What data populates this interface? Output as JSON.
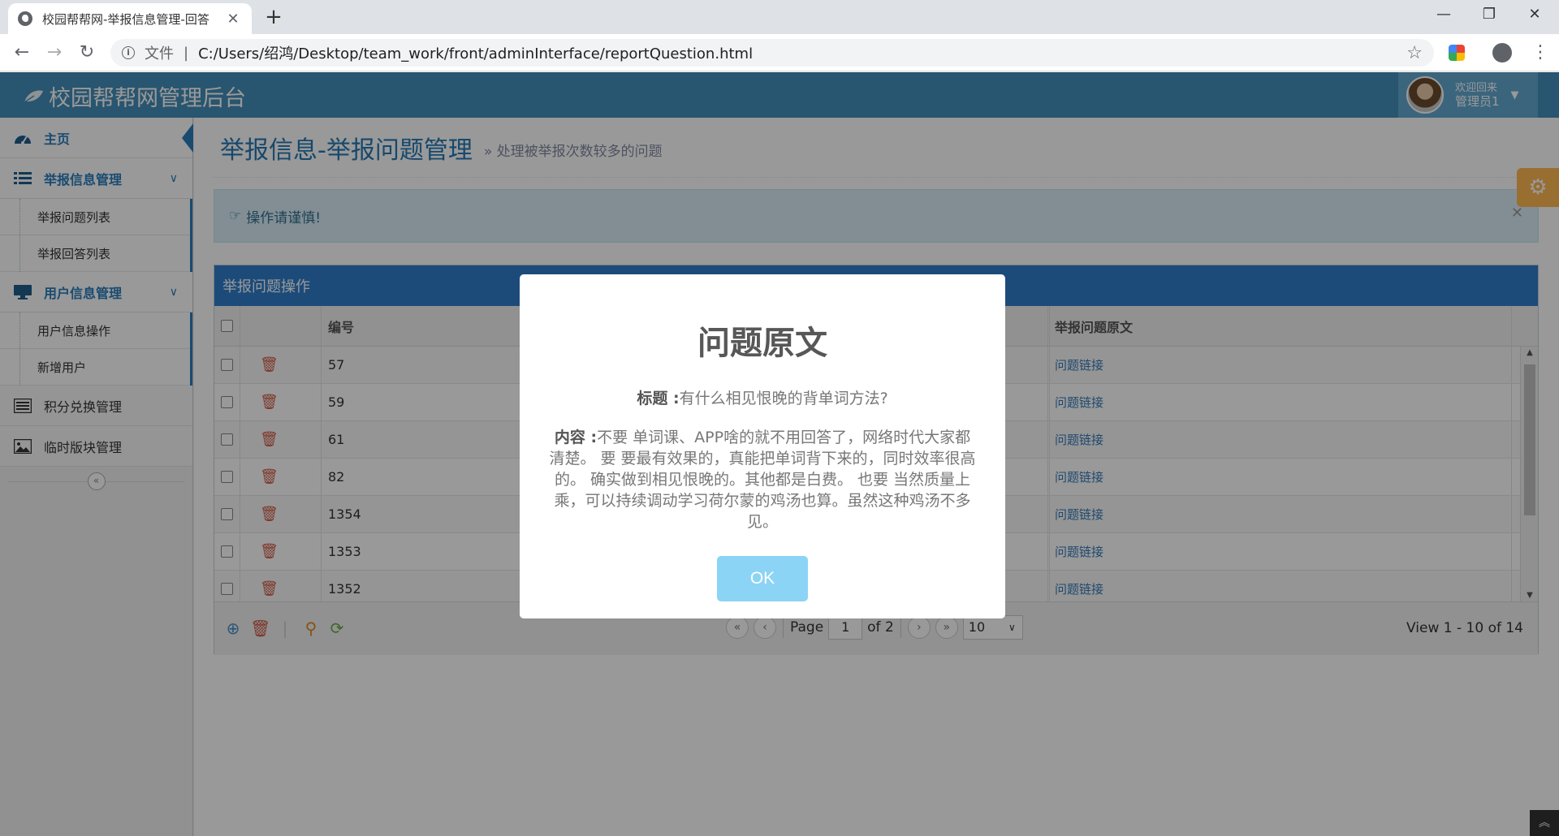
{
  "browser": {
    "tab_title": "校园帮帮网-举报信息管理-回答",
    "url_prefix": "文件",
    "url": "C:/Users/绍鸿/Desktop/team_work/front/adminInterface/reportQuestion.html"
  },
  "header": {
    "brand": "校园帮帮网管理后台",
    "welcome": "欢迎回来",
    "username": "管理员1"
  },
  "sidebar": {
    "items": [
      {
        "label": "主页"
      },
      {
        "label": "举报信息管理",
        "children": [
          "举报问题列表",
          "举报回答列表"
        ]
      },
      {
        "label": "用户信息管理",
        "children": [
          "用户信息操作",
          "新增用户"
        ]
      },
      {
        "label": "积分兑换管理"
      },
      {
        "label": "临时版块管理"
      }
    ]
  },
  "page": {
    "title": "举报信息-举报问题管理",
    "subtitle": "处理被举报次数较多的问题",
    "alert": "操作请谨慎!"
  },
  "grid": {
    "caption": "举报问题操作",
    "columns": {
      "id": "编号",
      "original": "举报问题原文"
    },
    "rows": [
      {
        "id": "57",
        "link": "问题链接"
      },
      {
        "id": "59",
        "link": "问题链接"
      },
      {
        "id": "61",
        "link": "问题链接"
      },
      {
        "id": "82",
        "link": "问题链接"
      },
      {
        "id": "1354",
        "link": "问题链接"
      },
      {
        "id": "1353",
        "link": "问题链接"
      },
      {
        "id": "1352",
        "link": "问题链接"
      }
    ],
    "pager": {
      "page_label": "Page",
      "page": "1",
      "of": "of 2",
      "page_size": "10",
      "info": "View 1 - 10 of 14"
    }
  },
  "modal": {
    "title": "问题原文",
    "title_label": "标题 :",
    "title_value": "有什么相见恨晚的背单词方法?",
    "content_label": "内容 :",
    "content_value": "不要 单词课、APP啥的就不用回答了，网络时代大家都清楚。 要 要最有效果的，真能把单词背下来的，同时效率很高的。 确实做到相见恨晚的。其他都是白费。 也要 当然质量上乘，可以持续调动学习荷尔蒙的鸡汤也算。虽然这种鸡汤不多见。",
    "ok": "OK"
  },
  "colors": {
    "header": "#438eb9",
    "caption": "#307ecc",
    "ok_button": "#8cd4f5",
    "settings": "#ffb752"
  }
}
